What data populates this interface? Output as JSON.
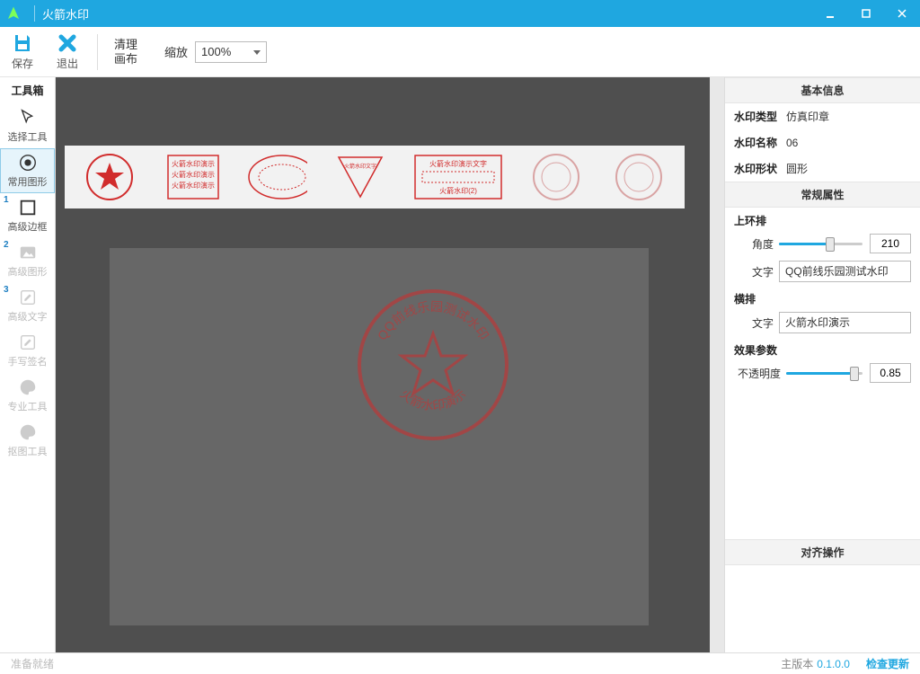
{
  "app": {
    "title": "火箭水印"
  },
  "toolbar": {
    "save": "保存",
    "exit": "退出",
    "clear": "清理\n画布",
    "zoom_label": "缩放",
    "zoom_value": "100%"
  },
  "sidebar": {
    "header": "工具箱",
    "items": [
      {
        "label": "选择工具",
        "icon": "cursor"
      },
      {
        "label": "常用图形",
        "icon": "circle-dot",
        "selected": true
      },
      {
        "label": "高级边框",
        "icon": "square",
        "badge": "1"
      },
      {
        "label": "高级图形",
        "icon": "image",
        "badge": "2",
        "disabled": true
      },
      {
        "label": "高级文字",
        "icon": "edit",
        "badge": "3",
        "disabled": true
      },
      {
        "label": "手写签名",
        "icon": "edit",
        "disabled": true
      },
      {
        "label": "专业工具",
        "icon": "palette",
        "disabled": true
      },
      {
        "label": "抠图工具",
        "icon": "palette",
        "disabled": true
      }
    ]
  },
  "canvas": {
    "stamp": {
      "top_arc_text": "QQ前线乐园测试水印",
      "bottom_arc_text": "火箭水印演示"
    },
    "gallery_labels": [
      "",
      "火箭水印演示",
      "",
      "",
      "火箭水印演示文字",
      "",
      ""
    ]
  },
  "panel": {
    "basic_header": "基本信息",
    "basic": {
      "type_k": "水印类型",
      "type_v": "仿真印章",
      "name_k": "水印名称",
      "name_v": "06",
      "shape_k": "水印形状",
      "shape_v": "圆形"
    },
    "general_header": "常规属性",
    "top_arc": {
      "header": "上环排",
      "angle_lbl": "角度",
      "angle_val": "210",
      "text_lbl": "文字",
      "text_val": "QQ前线乐园测试水印"
    },
    "horiz": {
      "header": "横排",
      "text_lbl": "文字",
      "text_val": "火箭水印演示"
    },
    "effect": {
      "header": "效果参数",
      "opacity_lbl": "不透明度",
      "opacity_val": "0.85"
    },
    "align_header": "对齐操作"
  },
  "status": {
    "ready": "准备就绪",
    "version_lbl": "主版本",
    "version": "0.1.0.0",
    "check": "检查更新"
  },
  "colors": {
    "accent": "#1fa7e0",
    "stamp_red": "#d12c2c"
  }
}
